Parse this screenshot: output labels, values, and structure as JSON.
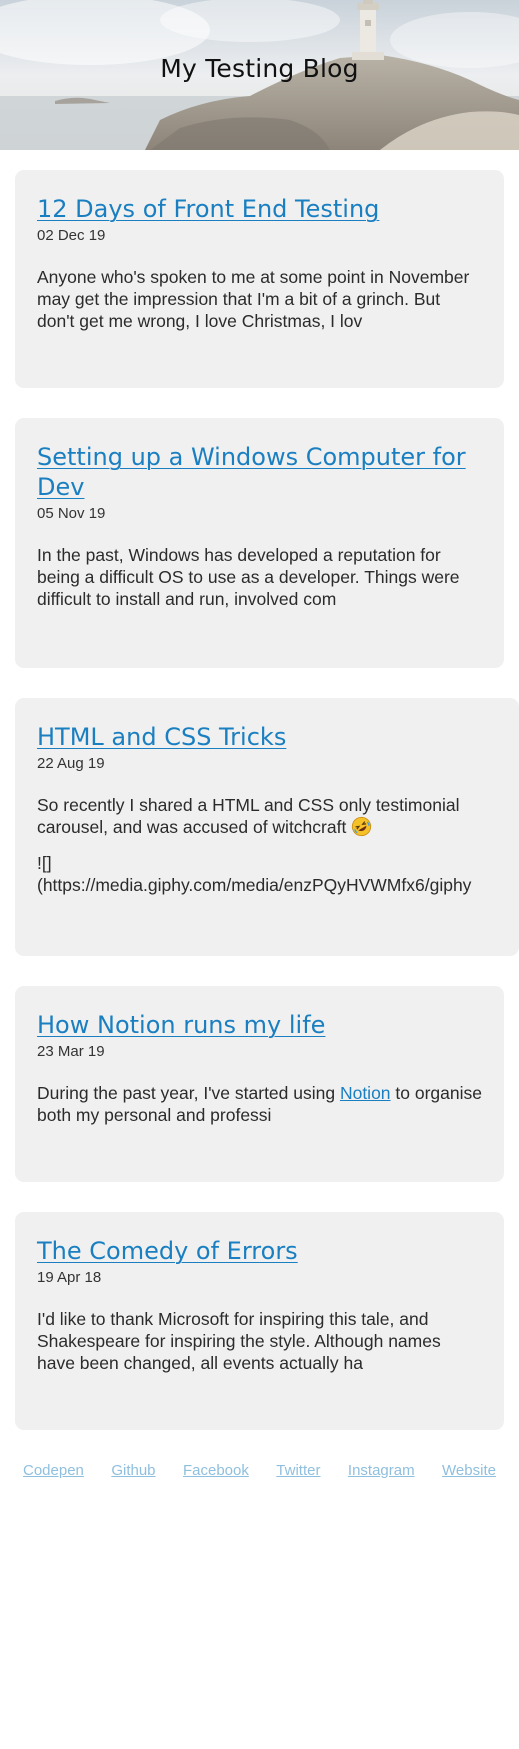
{
  "header": {
    "title": "My Testing Blog"
  },
  "posts": [
    {
      "title": "12 Days of Front End Testing",
      "date": "02 Dec 19",
      "excerpt": "Anyone who's spoken to me at some point in November may get the impression that I'm a bit of a grinch. But don't get me wrong, I love Christmas, I lov"
    },
    {
      "title": "Setting up a Windows Computer for Dev",
      "date": "05 Nov 19",
      "excerpt": "In the past, Windows has developed a reputation for being a difficult OS to use as a developer. Things were difficult to install and run, involved com"
    },
    {
      "title": "HTML and CSS Tricks",
      "date": "22 Aug 19",
      "excerpt": "So recently I shared a HTML and CSS only testimonial carousel, and was accused of witchcraft",
      "excerpt_emoji": "rolling-on-floor-laughing-emoji",
      "excerpt_line2a": "![]",
      "excerpt_line2b": "(https://media.giphy.com/media/enzPQyHVWMfx6/giphy"
    },
    {
      "title": "How Notion runs my life",
      "date": "23 Mar 19",
      "excerpt_before": "During the past year, I've started using ",
      "excerpt_link": "Notion",
      "excerpt_after": " to organise both my personal and professi"
    },
    {
      "title": "The Comedy of Errors",
      "date": "19 Apr 18",
      "excerpt": "I'd like to thank Microsoft for inspiring this tale, and Shakespeare for inspiring the style. Although names have been changed, all events actually ha"
    }
  ],
  "footer": {
    "links": [
      "Codepen",
      "Github",
      "Facebook",
      "Twitter",
      "Instagram",
      "Website"
    ]
  },
  "colors": {
    "link": "#1a7fc1",
    "footer_link": "#8fbfde",
    "card_bg": "#f0f0f0"
  }
}
